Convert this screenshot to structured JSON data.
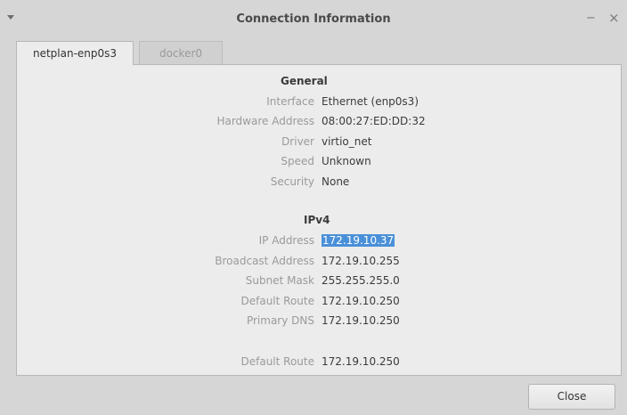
{
  "window": {
    "title": "Connection Information",
    "minimize_glyph": "−",
    "close_glyph": "×"
  },
  "tabs": [
    {
      "label": "netplan-enp0s3",
      "active": true
    },
    {
      "label": "docker0",
      "active": false
    }
  ],
  "general": {
    "title": "General",
    "rows": [
      {
        "label": "Interface",
        "value": "Ethernet (enp0s3)"
      },
      {
        "label": "Hardware Address",
        "value": "08:00:27:ED:DD:32"
      },
      {
        "label": "Driver",
        "value": "virtio_net"
      },
      {
        "label": "Speed",
        "value": "Unknown"
      },
      {
        "label": "Security",
        "value": "None"
      }
    ]
  },
  "ipv4": {
    "title": "IPv4",
    "rows": [
      {
        "label": "IP Address",
        "value": "172.19.10.37"
      },
      {
        "label": "Broadcast Address",
        "value": "172.19.10.255"
      },
      {
        "label": "Subnet Mask",
        "value": "255.255.255.0"
      },
      {
        "label": "Default Route",
        "value": "172.19.10.250"
      },
      {
        "label": "Primary DNS",
        "value": "172.19.10.250"
      }
    ],
    "extra": {
      "label": "Default Route",
      "value": "172.19.10.250"
    }
  },
  "footer": {
    "close_label": "Close"
  },
  "colors": {
    "selection": "#4a90d9",
    "panel": "#ececec",
    "window": "#d6d6d6"
  }
}
